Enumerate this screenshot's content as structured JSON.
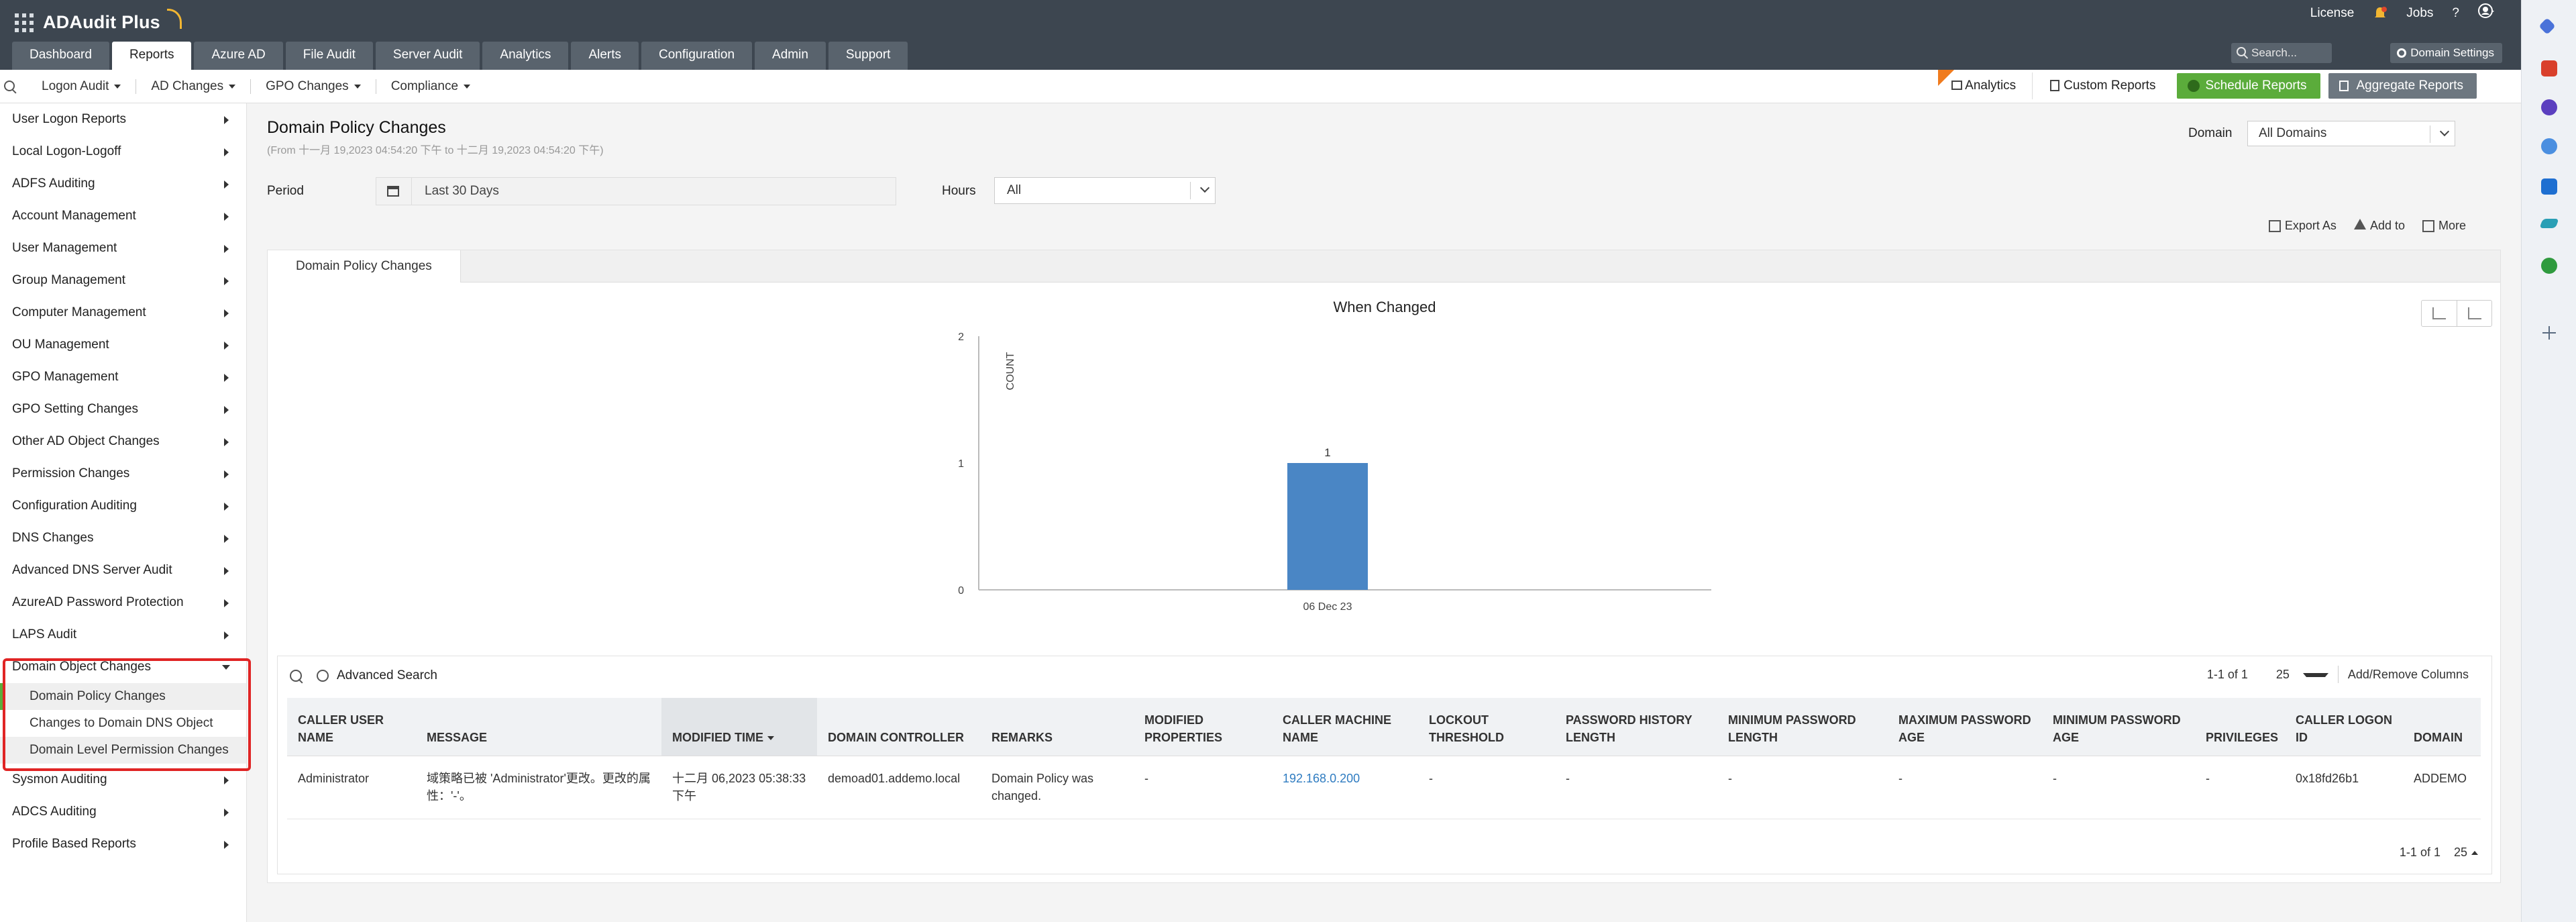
{
  "app": {
    "name": "ADAudit Plus"
  },
  "topbar": {
    "license": "License",
    "jobs": "Jobs",
    "help": "?",
    "search_placeholder": "Search...",
    "domain_settings": "Domain Settings",
    "tabs": [
      {
        "label": "Dashboard",
        "active": false
      },
      {
        "label": "Reports",
        "active": true
      },
      {
        "label": "Azure AD",
        "active": false
      },
      {
        "label": "File Audit",
        "active": false
      },
      {
        "label": "Server Audit",
        "active": false
      },
      {
        "label": "Analytics",
        "active": false
      },
      {
        "label": "Alerts",
        "active": false
      },
      {
        "label": "Configuration",
        "active": false
      },
      {
        "label": "Admin",
        "active": false
      },
      {
        "label": "Support",
        "active": false
      }
    ]
  },
  "subnav": {
    "items": [
      "Logon Audit",
      "AD Changes",
      "GPO Changes",
      "Compliance"
    ],
    "analytics": "Analytics",
    "custom_reports": "Custom Reports",
    "schedule_reports": "Schedule Reports",
    "aggregate_reports": "Aggregate Reports"
  },
  "sidebar": {
    "items": [
      "User Logon Reports",
      "Local Logon-Logoff",
      "ADFS Auditing",
      "Account Management",
      "User Management",
      "Group Management",
      "Computer Management",
      "OU Management",
      "GPO Management",
      "GPO Setting Changes",
      "Other AD Object Changes",
      "Permission Changes",
      "Configuration Auditing",
      "DNS Changes",
      "Advanced DNS Server Audit",
      "AzureAD Password Protection",
      "LAPS Audit"
    ],
    "expanded": {
      "label": "Domain Object Changes",
      "children": [
        "Domain Policy Changes",
        "Changes to Domain DNS Object",
        "Domain Level Permission Changes"
      ]
    },
    "items_after": [
      "Sysmon Auditing",
      "ADCS Auditing",
      "Profile Based Reports"
    ]
  },
  "main": {
    "title": "Domain Policy Changes",
    "subtitle": "(From 十一月 19,2023 04:54:20 下午 to 十二月 19,2023 04:54:20 下午)",
    "domain_label": "Domain",
    "domain_value": "All Domains",
    "period_label": "Period",
    "period_value": "Last 30 Days",
    "hours_label": "Hours",
    "hours_value": "All",
    "actions": [
      "Export As",
      "Add to",
      "More"
    ],
    "report_tab": "Domain Policy Changes"
  },
  "chart_data": {
    "type": "bar",
    "title": "When Changed",
    "categories": [
      "06 Dec 23"
    ],
    "values": [
      1
    ],
    "data_labels": [
      "1"
    ],
    "xlabel": "",
    "ylabel": "COUNT",
    "ylim": [
      0,
      2
    ],
    "yticks": [
      "0",
      "1",
      "2"
    ],
    "bar_color": "#4a86c5"
  },
  "table": {
    "advanced_search": "Advanced Search",
    "range": "1-1 of 1",
    "page_size": "25",
    "add_remove": "Add/Remove Columns",
    "columns": [
      "CALLER USER NAME",
      "MESSAGE",
      "MODIFIED TIME",
      "DOMAIN CONTROLLER",
      "REMARKS",
      "MODIFIED PROPERTIES",
      "CALLER MACHINE NAME",
      "LOCKOUT THRESHOLD",
      "PASSWORD HISTORY LENGTH",
      "MINIMUM PASSWORD LENGTH",
      "MAXIMUM PASSWORD AGE",
      "MINIMUM PASSWORD AGE",
      "PRIVILEGES",
      "CALLER LOGON ID",
      "DOMAIN"
    ],
    "rows": [
      [
        "Administrator",
        "域策略已被 'Administrator'更改。更改的属性：'-'。",
        "十二月 06,2023 05:38:33 下午",
        "demoad01.addemo.local",
        "Domain Policy was changed.",
        "-",
        "192.168.0.200",
        "-",
        "-",
        "-",
        "-",
        "-",
        "-",
        "0x18fd26b1",
        "ADDEMO"
      ]
    ]
  }
}
